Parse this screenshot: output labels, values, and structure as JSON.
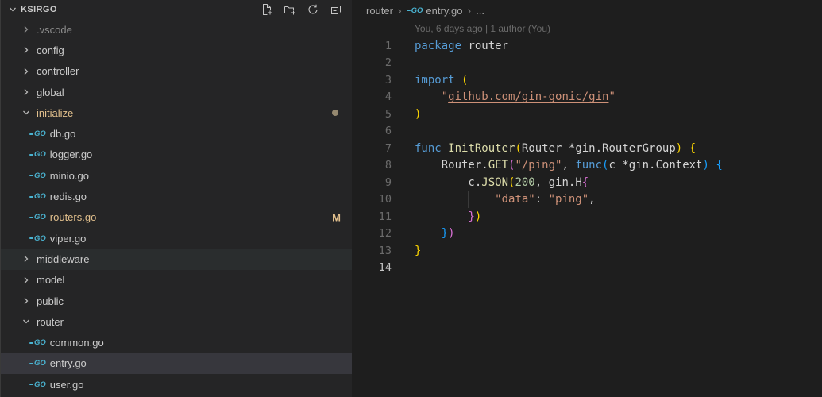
{
  "colors": {
    "sidebar_bg": "#252526",
    "editor_bg": "#1e1e1e",
    "hover": "#2a2d2e",
    "selection": "#37373d",
    "modified": "#e2c08d",
    "ignored": "#8c8c8c",
    "go_icon": "#4ab3d1",
    "keyword": "#569cd6",
    "function": "#dcdcaa",
    "string": "#ce9178",
    "number": "#b5cea8",
    "plain": "#d4d4d4",
    "bracket1": "#ffd700",
    "bracket2": "#da70d6",
    "bracket3": "#179fff"
  },
  "explorer": {
    "root_label": "KSIRGO",
    "toolbar": [
      {
        "name": "new-file"
      },
      {
        "name": "new-folder"
      },
      {
        "name": "refresh-explorer"
      },
      {
        "name": "collapse-folders"
      }
    ],
    "items": [
      {
        "label": ".vscode",
        "kind": "folder",
        "level": 0,
        "expanded": false,
        "color": "ignored",
        "badge": null,
        "state": null
      },
      {
        "label": "config",
        "kind": "folder",
        "level": 0,
        "expanded": false,
        "color": "default",
        "badge": null,
        "state": null
      },
      {
        "label": "controller",
        "kind": "folder",
        "level": 0,
        "expanded": false,
        "color": "default",
        "badge": null,
        "state": null
      },
      {
        "label": "global",
        "kind": "folder",
        "level": 0,
        "expanded": false,
        "color": "default",
        "badge": null,
        "state": null
      },
      {
        "label": "initialize",
        "kind": "folder",
        "level": 0,
        "expanded": true,
        "color": "modified",
        "badge": "dot",
        "state": null
      },
      {
        "label": "db.go",
        "kind": "file",
        "level": 1,
        "color": "default",
        "badge": null,
        "state": null
      },
      {
        "label": "logger.go",
        "kind": "file",
        "level": 1,
        "color": "default",
        "badge": null,
        "state": null
      },
      {
        "label": "minio.go",
        "kind": "file",
        "level": 1,
        "color": "default",
        "badge": null,
        "state": null
      },
      {
        "label": "redis.go",
        "kind": "file",
        "level": 1,
        "color": "default",
        "badge": null,
        "state": null
      },
      {
        "label": "routers.go",
        "kind": "file",
        "level": 1,
        "color": "modified",
        "badge": "M",
        "state": null
      },
      {
        "label": "viper.go",
        "kind": "file",
        "level": 1,
        "color": "default",
        "badge": null,
        "state": null
      },
      {
        "label": "middleware",
        "kind": "folder",
        "level": 0,
        "expanded": false,
        "color": "default",
        "badge": null,
        "state": "hover"
      },
      {
        "label": "model",
        "kind": "folder",
        "level": 0,
        "expanded": false,
        "color": "default",
        "badge": null,
        "state": null
      },
      {
        "label": "public",
        "kind": "folder",
        "level": 0,
        "expanded": false,
        "color": "default",
        "badge": null,
        "state": null
      },
      {
        "label": "router",
        "kind": "folder",
        "level": 0,
        "expanded": true,
        "color": "default",
        "badge": null,
        "state": null
      },
      {
        "label": "common.go",
        "kind": "file",
        "level": 1,
        "color": "default",
        "badge": null,
        "state": null
      },
      {
        "label": "entry.go",
        "kind": "file",
        "level": 1,
        "color": "default",
        "badge": null,
        "state": "selected"
      },
      {
        "label": "user.go",
        "kind": "file",
        "level": 1,
        "color": "default",
        "badge": null,
        "state": null
      }
    ]
  },
  "editor": {
    "breadcrumbs": {
      "separator": "›",
      "items": [
        {
          "label": "router",
          "icon": null
        },
        {
          "label": "entry.go",
          "icon": "go"
        },
        {
          "label": "...",
          "icon": null
        }
      ]
    },
    "blame": "You, 6 days ago | 1 author (You)",
    "lines": [
      {
        "n": 1,
        "guides": [],
        "current": false,
        "tokens": [
          [
            "kw",
            "package"
          ],
          [
            "pl",
            " router"
          ]
        ]
      },
      {
        "n": 2,
        "guides": [],
        "current": false,
        "tokens": []
      },
      {
        "n": 3,
        "guides": [],
        "current": false,
        "tokens": [
          [
            "kw",
            "import"
          ],
          [
            "pl",
            " "
          ],
          [
            "b1",
            "("
          ]
        ]
      },
      {
        "n": 4,
        "guides": [
          0
        ],
        "current": false,
        "tokens": [
          [
            "pl",
            "    "
          ],
          [
            "str",
            "\""
          ],
          [
            "lnk",
            "github.com/gin-gonic/gin"
          ],
          [
            "str",
            "\""
          ]
        ]
      },
      {
        "n": 5,
        "guides": [],
        "current": false,
        "tokens": [
          [
            "b1",
            ")"
          ]
        ]
      },
      {
        "n": 6,
        "guides": [],
        "current": false,
        "tokens": []
      },
      {
        "n": 7,
        "guides": [],
        "current": false,
        "tokens": [
          [
            "kw",
            "func"
          ],
          [
            "pl",
            " "
          ],
          [
            "fn",
            "InitRouter"
          ],
          [
            "b1",
            "("
          ],
          [
            "pl",
            "Router *gin.RouterGroup"
          ],
          [
            "b1",
            ")"
          ],
          [
            "pl",
            " "
          ],
          [
            "b1",
            "{"
          ]
        ]
      },
      {
        "n": 8,
        "guides": [
          0
        ],
        "current": false,
        "tokens": [
          [
            "pl",
            "    Router."
          ],
          [
            "fn",
            "GET"
          ],
          [
            "b2",
            "("
          ],
          [
            "str",
            "\"/ping\""
          ],
          [
            "pl",
            ", "
          ],
          [
            "kw",
            "func"
          ],
          [
            "b3",
            "("
          ],
          [
            "pl",
            "c *gin.Context"
          ],
          [
            "b3",
            ")"
          ],
          [
            "pl",
            " "
          ],
          [
            "b3",
            "{"
          ]
        ]
      },
      {
        "n": 9,
        "guides": [
          0,
          1
        ],
        "current": false,
        "tokens": [
          [
            "pl",
            "        c."
          ],
          [
            "fn",
            "JSON"
          ],
          [
            "b1",
            "("
          ],
          [
            "num",
            "200"
          ],
          [
            "pl",
            ", gin.H"
          ],
          [
            "b2",
            "{"
          ]
        ]
      },
      {
        "n": 10,
        "guides": [
          0,
          1,
          2
        ],
        "current": false,
        "tokens": [
          [
            "pl",
            "            "
          ],
          [
            "str",
            "\"data\""
          ],
          [
            "pl",
            ": "
          ],
          [
            "str",
            "\"ping\""
          ],
          [
            "pl",
            ","
          ]
        ]
      },
      {
        "n": 11,
        "guides": [
          0,
          1
        ],
        "current": false,
        "tokens": [
          [
            "pl",
            "        "
          ],
          [
            "b2",
            "}"
          ],
          [
            "b1",
            ")"
          ]
        ]
      },
      {
        "n": 12,
        "guides": [
          0
        ],
        "current": false,
        "tokens": [
          [
            "pl",
            "    "
          ],
          [
            "b3",
            "}"
          ],
          [
            "b2",
            ")"
          ]
        ]
      },
      {
        "n": 13,
        "guides": [],
        "current": false,
        "tokens": [
          [
            "b1",
            "}"
          ]
        ]
      },
      {
        "n": 14,
        "guides": [],
        "current": true,
        "tokens": []
      }
    ]
  }
}
